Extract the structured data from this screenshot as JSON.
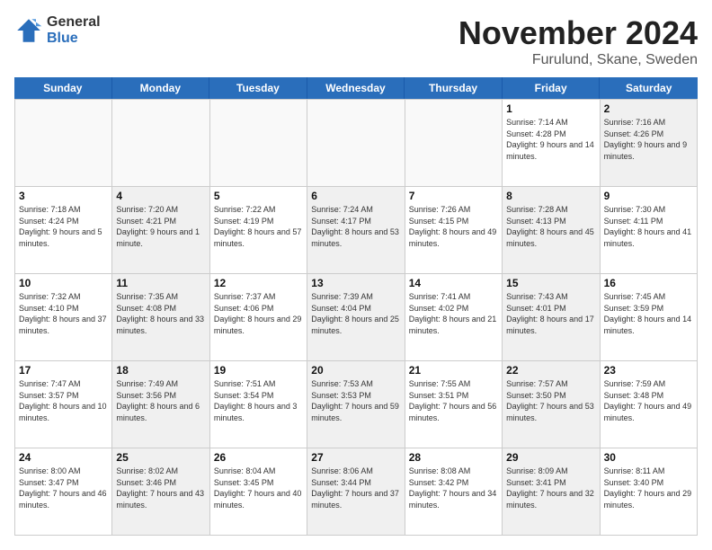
{
  "logo": {
    "general": "General",
    "blue": "Blue"
  },
  "title": "November 2024",
  "location": "Furulund, Skane, Sweden",
  "weekdays": [
    "Sunday",
    "Monday",
    "Tuesday",
    "Wednesday",
    "Thursday",
    "Friday",
    "Saturday"
  ],
  "weeks": [
    [
      {
        "day": "",
        "info": "",
        "empty": true
      },
      {
        "day": "",
        "info": "",
        "empty": true
      },
      {
        "day": "",
        "info": "",
        "empty": true
      },
      {
        "day": "",
        "info": "",
        "empty": true
      },
      {
        "day": "",
        "info": "",
        "empty": true
      },
      {
        "day": "1",
        "info": "Sunrise: 7:14 AM\nSunset: 4:28 PM\nDaylight: 9 hours and 14 minutes.",
        "shaded": false
      },
      {
        "day": "2",
        "info": "Sunrise: 7:16 AM\nSunset: 4:26 PM\nDaylight: 9 hours and 9 minutes.",
        "shaded": true
      }
    ],
    [
      {
        "day": "3",
        "info": "Sunrise: 7:18 AM\nSunset: 4:24 PM\nDaylight: 9 hours and 5 minutes.",
        "shaded": false
      },
      {
        "day": "4",
        "info": "Sunrise: 7:20 AM\nSunset: 4:21 PM\nDaylight: 9 hours and 1 minute.",
        "shaded": true
      },
      {
        "day": "5",
        "info": "Sunrise: 7:22 AM\nSunset: 4:19 PM\nDaylight: 8 hours and 57 minutes.",
        "shaded": false
      },
      {
        "day": "6",
        "info": "Sunrise: 7:24 AM\nSunset: 4:17 PM\nDaylight: 8 hours and 53 minutes.",
        "shaded": true
      },
      {
        "day": "7",
        "info": "Sunrise: 7:26 AM\nSunset: 4:15 PM\nDaylight: 8 hours and 49 minutes.",
        "shaded": false
      },
      {
        "day": "8",
        "info": "Sunrise: 7:28 AM\nSunset: 4:13 PM\nDaylight: 8 hours and 45 minutes.",
        "shaded": true
      },
      {
        "day": "9",
        "info": "Sunrise: 7:30 AM\nSunset: 4:11 PM\nDaylight: 8 hours and 41 minutes.",
        "shaded": false
      }
    ],
    [
      {
        "day": "10",
        "info": "Sunrise: 7:32 AM\nSunset: 4:10 PM\nDaylight: 8 hours and 37 minutes.",
        "shaded": false
      },
      {
        "day": "11",
        "info": "Sunrise: 7:35 AM\nSunset: 4:08 PM\nDaylight: 8 hours and 33 minutes.",
        "shaded": true
      },
      {
        "day": "12",
        "info": "Sunrise: 7:37 AM\nSunset: 4:06 PM\nDaylight: 8 hours and 29 minutes.",
        "shaded": false
      },
      {
        "day": "13",
        "info": "Sunrise: 7:39 AM\nSunset: 4:04 PM\nDaylight: 8 hours and 25 minutes.",
        "shaded": true
      },
      {
        "day": "14",
        "info": "Sunrise: 7:41 AM\nSunset: 4:02 PM\nDaylight: 8 hours and 21 minutes.",
        "shaded": false
      },
      {
        "day": "15",
        "info": "Sunrise: 7:43 AM\nSunset: 4:01 PM\nDaylight: 8 hours and 17 minutes.",
        "shaded": true
      },
      {
        "day": "16",
        "info": "Sunrise: 7:45 AM\nSunset: 3:59 PM\nDaylight: 8 hours and 14 minutes.",
        "shaded": false
      }
    ],
    [
      {
        "day": "17",
        "info": "Sunrise: 7:47 AM\nSunset: 3:57 PM\nDaylight: 8 hours and 10 minutes.",
        "shaded": false
      },
      {
        "day": "18",
        "info": "Sunrise: 7:49 AM\nSunset: 3:56 PM\nDaylight: 8 hours and 6 minutes.",
        "shaded": true
      },
      {
        "day": "19",
        "info": "Sunrise: 7:51 AM\nSunset: 3:54 PM\nDaylight: 8 hours and 3 minutes.",
        "shaded": false
      },
      {
        "day": "20",
        "info": "Sunrise: 7:53 AM\nSunset: 3:53 PM\nDaylight: 7 hours and 59 minutes.",
        "shaded": true
      },
      {
        "day": "21",
        "info": "Sunrise: 7:55 AM\nSunset: 3:51 PM\nDaylight: 7 hours and 56 minutes.",
        "shaded": false
      },
      {
        "day": "22",
        "info": "Sunrise: 7:57 AM\nSunset: 3:50 PM\nDaylight: 7 hours and 53 minutes.",
        "shaded": true
      },
      {
        "day": "23",
        "info": "Sunrise: 7:59 AM\nSunset: 3:48 PM\nDaylight: 7 hours and 49 minutes.",
        "shaded": false
      }
    ],
    [
      {
        "day": "24",
        "info": "Sunrise: 8:00 AM\nSunset: 3:47 PM\nDaylight: 7 hours and 46 minutes.",
        "shaded": false
      },
      {
        "day": "25",
        "info": "Sunrise: 8:02 AM\nSunset: 3:46 PM\nDaylight: 7 hours and 43 minutes.",
        "shaded": true
      },
      {
        "day": "26",
        "info": "Sunrise: 8:04 AM\nSunset: 3:45 PM\nDaylight: 7 hours and 40 minutes.",
        "shaded": false
      },
      {
        "day": "27",
        "info": "Sunrise: 8:06 AM\nSunset: 3:44 PM\nDaylight: 7 hours and 37 minutes.",
        "shaded": true
      },
      {
        "day": "28",
        "info": "Sunrise: 8:08 AM\nSunset: 3:42 PM\nDaylight: 7 hours and 34 minutes.",
        "shaded": false
      },
      {
        "day": "29",
        "info": "Sunrise: 8:09 AM\nSunset: 3:41 PM\nDaylight: 7 hours and 32 minutes.",
        "shaded": true
      },
      {
        "day": "30",
        "info": "Sunrise: 8:11 AM\nSunset: 3:40 PM\nDaylight: 7 hours and 29 minutes.",
        "shaded": false
      }
    ]
  ]
}
